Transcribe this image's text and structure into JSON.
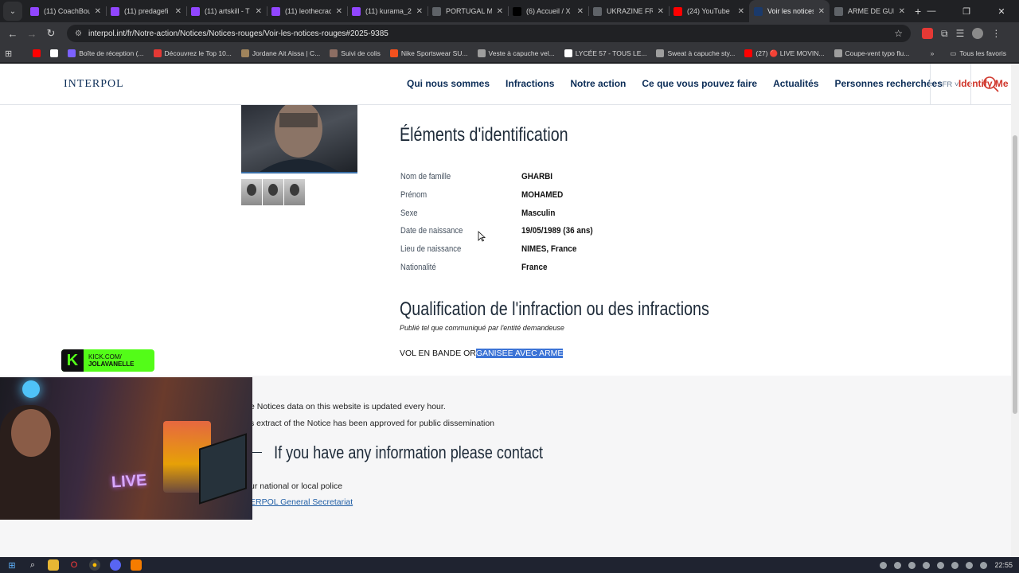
{
  "browser": {
    "tabs": [
      {
        "title": "(11) CoachBou",
        "icon": "twitch-icon",
        "color": "#9146ff"
      },
      {
        "title": "(11) predagefi",
        "icon": "twitch-icon",
        "color": "#9146ff"
      },
      {
        "title": "(11) artskill - T",
        "icon": "twitch-icon",
        "color": "#9146ff"
      },
      {
        "title": "(11) leothecrac",
        "icon": "twitch-icon",
        "color": "#9146ff"
      },
      {
        "title": "(11) kurama_2",
        "icon": "twitch-icon",
        "color": "#9146ff"
      },
      {
        "title": "PORTUGAL MA",
        "icon": "chrome-icon",
        "color": "#5f6368"
      },
      {
        "title": "(6) Accueil / X",
        "icon": "x-icon",
        "color": "#000000"
      },
      {
        "title": "UKRAZINE FRA",
        "icon": "chrome-icon",
        "color": "#5f6368"
      },
      {
        "title": "(24) YouTube",
        "icon": "youtube-icon",
        "color": "#ff0000"
      },
      {
        "title": "Voir les notices",
        "icon": "interpol-icon",
        "color": "#1b3a6b",
        "active": true
      },
      {
        "title": "ARME DE GUE",
        "icon": "chrome-icon",
        "color": "#5f6368"
      }
    ],
    "url": "interpol.int/fr/Notre-action/Notices/Notices-rouges/Voir-les-notices-rouges#2025-9385",
    "bookmarks": [
      {
        "label": "",
        "icon": "youtube-icon",
        "color": "#ff0000"
      },
      {
        "label": "",
        "icon": "gmail-icon",
        "color": "#ffffff"
      },
      {
        "label": "Boîte de réception (...",
        "icon": "mail-icon",
        "color": "#7b61ff"
      },
      {
        "label": "Découvrez le Top 10...",
        "icon": "tl-icon",
        "color": "#e53935"
      },
      {
        "label": "Jordane Ait Aissa | C...",
        "icon": "person-icon",
        "color": "#a0845c"
      },
      {
        "label": "Suivi de colis",
        "icon": "package-icon",
        "color": "#8d6e63"
      },
      {
        "label": "Nike Sportswear SU...",
        "icon": "nike-icon",
        "color": "#f4511e"
      },
      {
        "label": "Veste à capuche vel...",
        "icon": "shop-icon",
        "color": "#9e9e9e"
      },
      {
        "label": "LYCÉE 57 - TOUS LE...",
        "icon": "yahoo-icon",
        "color": "#ffffff"
      },
      {
        "label": "Sweat à capuche sty...",
        "icon": "shop-icon",
        "color": "#9e9e9e"
      },
      {
        "label": "(27) 🔴 LIVE MOVIN...",
        "icon": "youtube-icon",
        "color": "#ff0000"
      },
      {
        "label": "Coupe-vent typo flu...",
        "icon": "shop-icon",
        "color": "#9e9e9e"
      }
    ],
    "all_bookmarks": "Tous les favoris"
  },
  "site": {
    "logo": "INTERPOL",
    "nav": [
      "Qui nous sommes",
      "Infractions",
      "Notre action",
      "Ce que vous pouvez faire",
      "Actualités",
      "Personnes recherchées"
    ],
    "identify": "Identify Me",
    "lang": "FR ˅"
  },
  "notice": {
    "id_heading": "Éléments d'identification",
    "fields": [
      {
        "label": "Nom de famille",
        "value": "GHARBI"
      },
      {
        "label": "Prénom",
        "value": "MOHAMED"
      },
      {
        "label": "Sexe",
        "value": "Masculin"
      },
      {
        "label": "Date de naissance",
        "value": "19/05/1989 (36 ans)"
      },
      {
        "label": "Lieu de naissance",
        "value": "NIMES, France"
      },
      {
        "label": "Nationalité",
        "value": "France"
      }
    ],
    "charges_heading": "Qualification de l'infraction ou des infractions",
    "published_note": "Publié tel que communiqué par l'entité demandeuse",
    "charge_plain": "VOL EN BANDE OR",
    "charge_selected": "GANISEE AVEC ARME"
  },
  "footer": {
    "line1": "e Notices data on this website is updated every hour.",
    "line2": "s extract of the Notice has been approved for public dissemination",
    "contact_title": "If you have any information please contact",
    "line3": "ur national or local police",
    "link": "ERPOL General Secretariat"
  },
  "overlay": {
    "kick_line1": "KICK.COM/",
    "kick_line2": "JOLAVANELLE",
    "neon": "LIVE"
  },
  "taskbar": {
    "clock": "22:55"
  }
}
